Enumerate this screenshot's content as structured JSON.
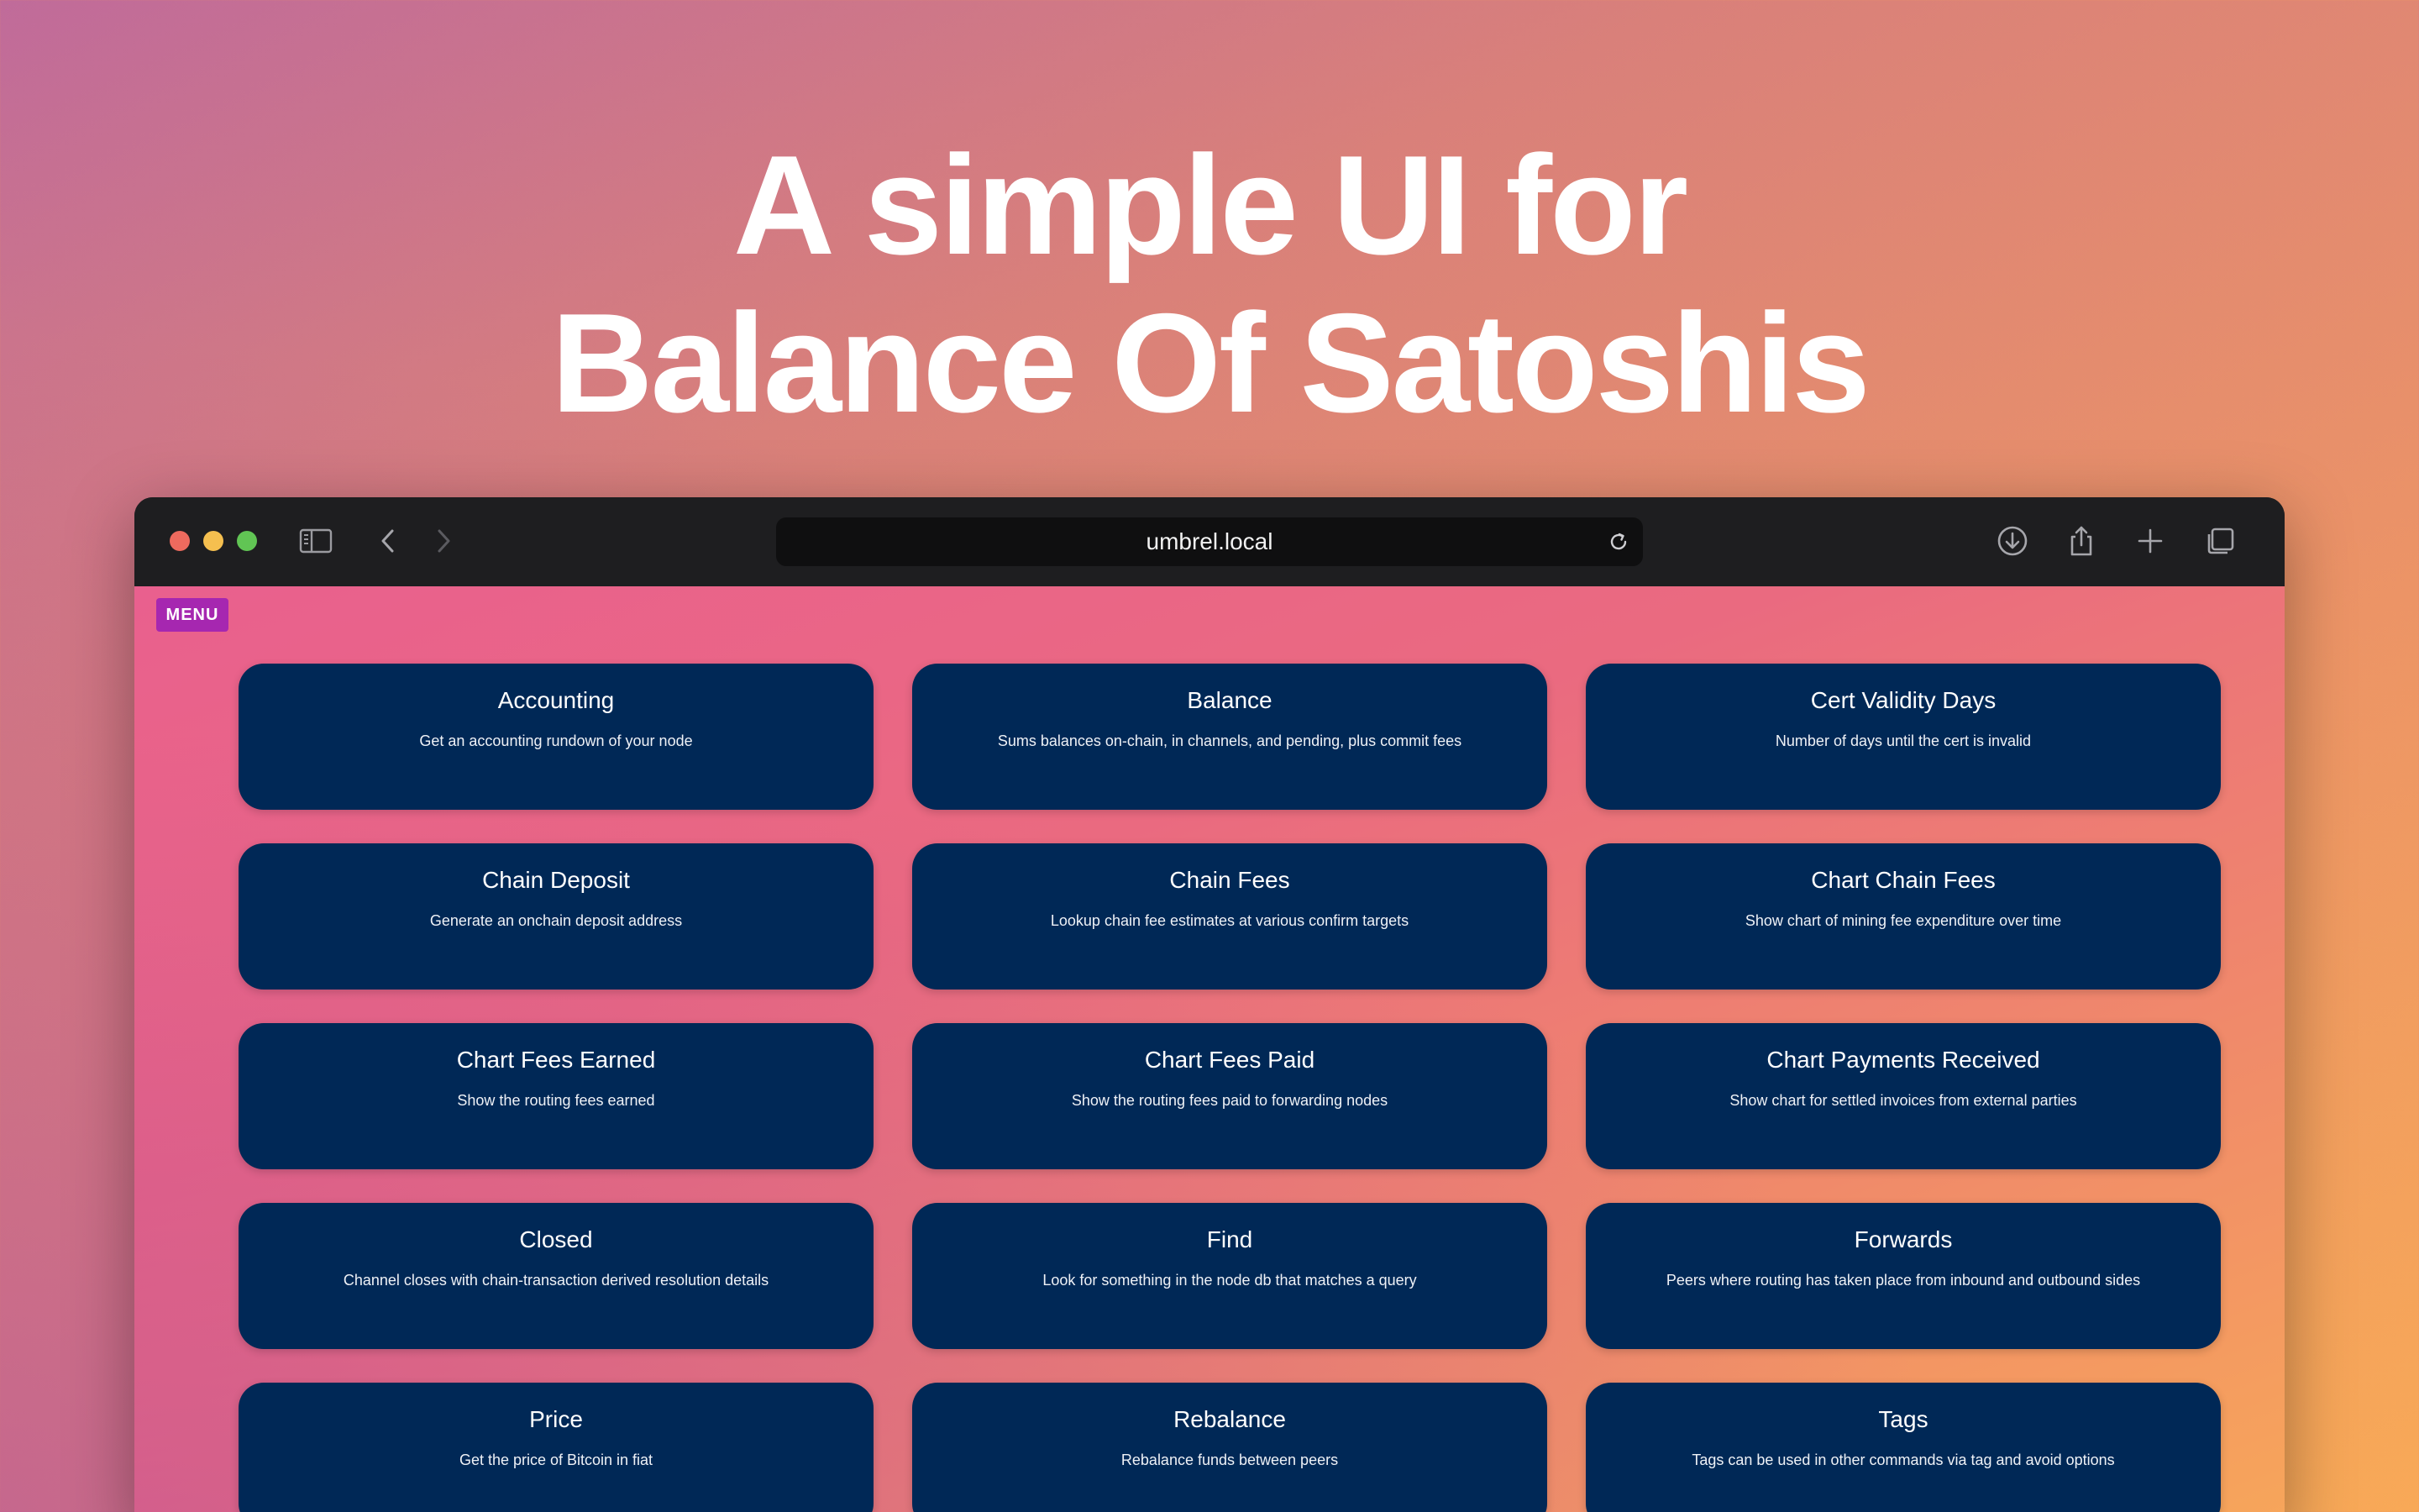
{
  "headline": {
    "line1": "A simple UI for",
    "line2": "Balance Of Satoshis"
  },
  "browser": {
    "url": "umbrel.local",
    "icons": {
      "sidebar": "sidebar-icon",
      "back": "chevron-left-icon",
      "forward": "chevron-right-icon",
      "reload": "reload-icon",
      "download": "download-icon",
      "share": "share-icon",
      "new_tab": "plus-icon",
      "tabs": "tabs-overview-icon"
    }
  },
  "app": {
    "menu_label": "MENU",
    "commands": [
      {
        "title": "Accounting",
        "description": "Get an accounting rundown of your node"
      },
      {
        "title": "Balance",
        "description": "Sums balances on-chain, in channels, and pending, plus commit fees"
      },
      {
        "title": "Cert Validity Days",
        "description": "Number of days until the cert is invalid"
      },
      {
        "title": "Chain Deposit",
        "description": "Generate an onchain deposit address"
      },
      {
        "title": "Chain Fees",
        "description": "Lookup chain fee estimates at various confirm targets"
      },
      {
        "title": "Chart Chain Fees",
        "description": "Show chart of mining fee expenditure over time"
      },
      {
        "title": "Chart Fees Earned",
        "description": "Show the routing fees earned"
      },
      {
        "title": "Chart Fees Paid",
        "description": "Show the routing fees paid to forwarding nodes"
      },
      {
        "title": "Chart Payments Received",
        "description": "Show chart for settled invoices from external parties"
      },
      {
        "title": "Closed",
        "description": "Channel closes with chain-transaction derived resolution details"
      },
      {
        "title": "Find",
        "description": "Look for something in the node db that matches a query"
      },
      {
        "title": "Forwards",
        "description": "Peers where routing has taken place from inbound and outbound sides"
      },
      {
        "title": "Price",
        "description": "Get the price of Bitcoin in fiat"
      },
      {
        "title": "Rebalance",
        "description": "Rebalance funds between peers"
      },
      {
        "title": "Tags",
        "description": "Tags can be used in other commands via tag and avoid options"
      }
    ]
  },
  "colors": {
    "card_bg": "#002856",
    "menu_bg": "#a627b0",
    "toolbar_bg": "#1e1e20"
  }
}
